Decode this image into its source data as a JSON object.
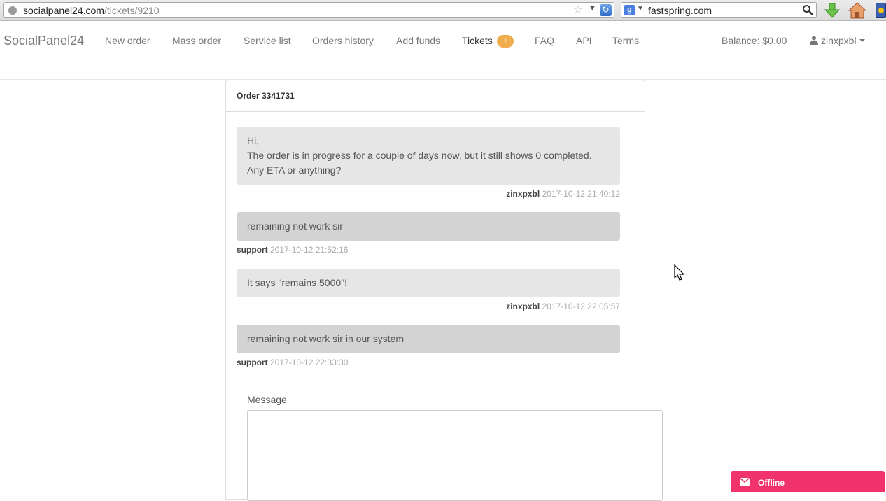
{
  "browser": {
    "url_domain": "socialpanel24.com",
    "url_path": "/tickets/9210",
    "search_engine_icon": "g",
    "search_text": "fastspring.com"
  },
  "navbar": {
    "brand": "SocialPanel24",
    "items": [
      {
        "label": "New order"
      },
      {
        "label": "Mass order"
      },
      {
        "label": "Service list"
      },
      {
        "label": "Orders history"
      },
      {
        "label": "Add funds"
      },
      {
        "label": "Tickets",
        "badge": "!"
      },
      {
        "label": "FAQ"
      },
      {
        "label": "API"
      },
      {
        "label": "Terms"
      }
    ],
    "balance": "Balance: $0.00",
    "username": "zinxpxbl"
  },
  "ticket": {
    "title": "Order 3341731",
    "messages": [
      {
        "lines": [
          "Hi,",
          "The order is in progress for a couple of days now, but it still shows 0 completed.",
          "Any ETA or anything?"
        ],
        "author": "zinxpxbl",
        "time": "2017-10-12 21:40:12"
      },
      {
        "lines": [
          "remaining not work sir"
        ],
        "author": "support",
        "time": "2017-10-12 21:52:16"
      },
      {
        "lines": [
          "It says \"remains 5000\"!"
        ],
        "author": "zinxpxbl",
        "time": "2017-10-12 22:05:57"
      },
      {
        "lines": [
          "remaining not work sir in our system"
        ],
        "author": "support",
        "time": "2017-10-12 22:33:30"
      }
    ],
    "message_label": "Message",
    "message_value": ""
  },
  "chat_widget": {
    "label": "Offline",
    "color": "#f0336a"
  }
}
